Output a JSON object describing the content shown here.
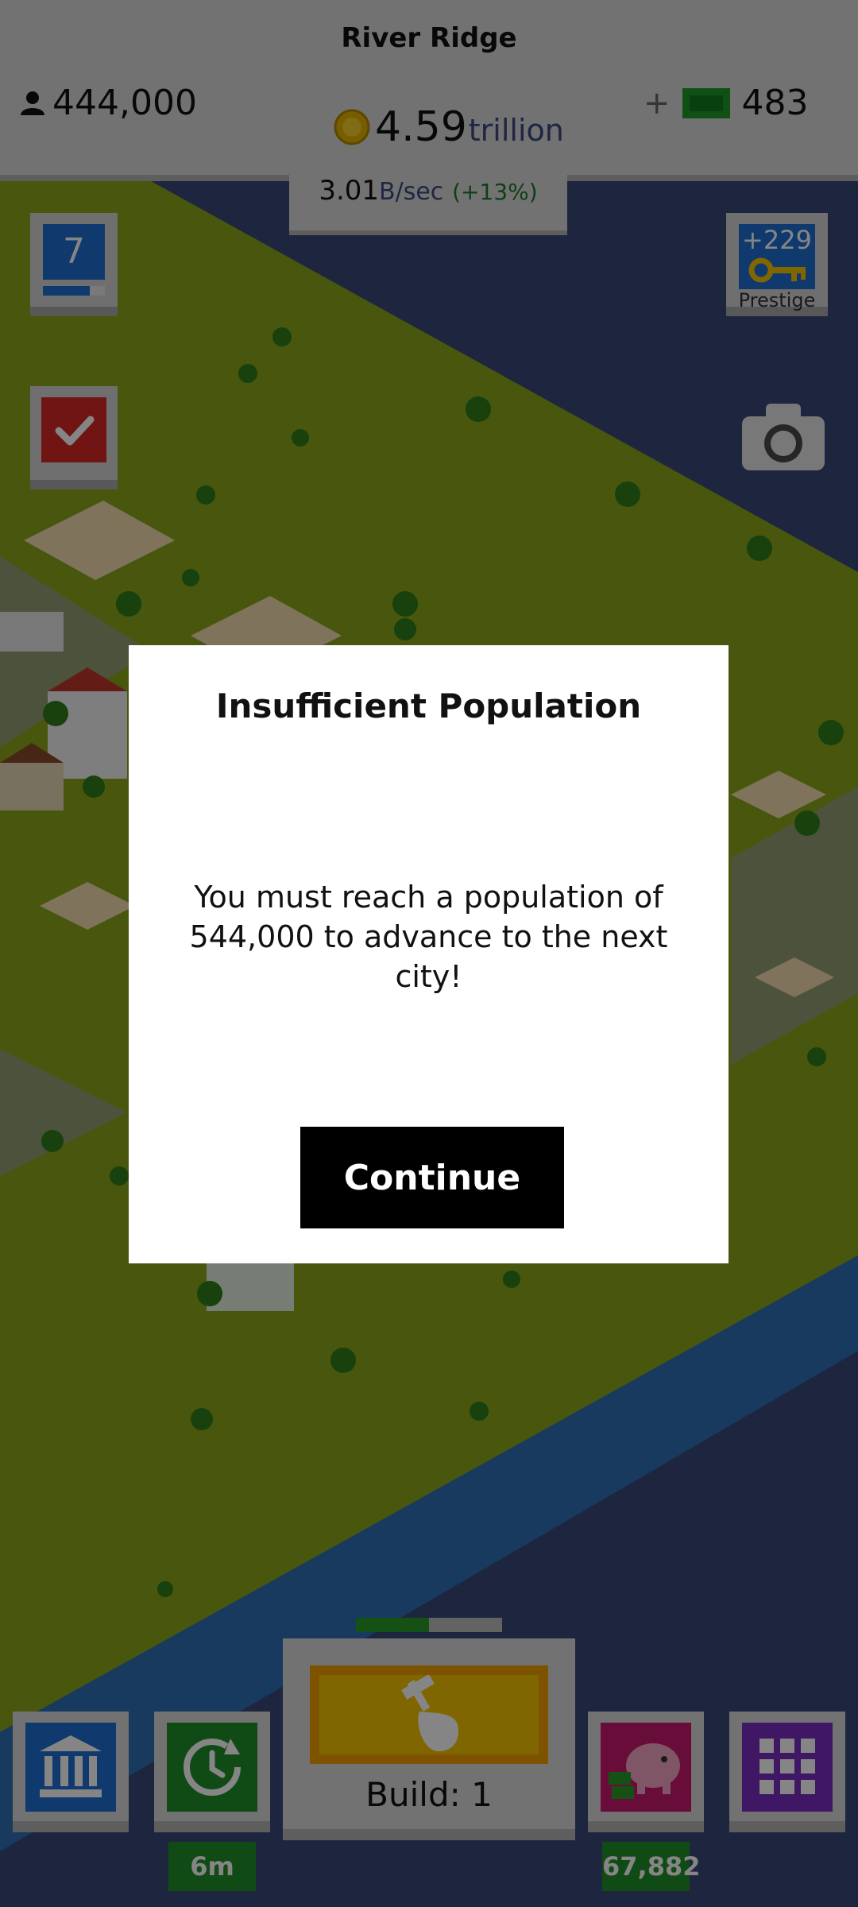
{
  "header": {
    "city_name": "River Ridge",
    "population": "444,000",
    "coins_amount": "4.59",
    "coins_unit": "trillion",
    "rate_value": "3.01",
    "rate_unit": "B/sec",
    "rate_change": "(+13%)",
    "cash_plus": "+",
    "cash_amount": "483"
  },
  "side_buttons": {
    "level_value": "7",
    "level_progress": 0.75,
    "prestige_value": "+229",
    "prestige_label": "Prestige"
  },
  "dialog": {
    "title": "Insufficient Population",
    "message": "You must reach a population of\n544,000  to advance to the next city!",
    "continue_label": "Continue"
  },
  "bottom_bar": {
    "build_label": "Build: 1",
    "build_progress": 0.5,
    "timer_label": "6m",
    "bank_value": "67,882"
  },
  "icons": [
    "person-icon",
    "coin-icon",
    "cash-icon",
    "checkmark-icon",
    "key-icon",
    "camera-icon",
    "bank-icon",
    "clock-icon",
    "hammer-hand-icon",
    "piggy-bank-icon",
    "grid-icon"
  ],
  "colors": {
    "level_blue": "#1f6fd1",
    "task_red": "#d62828",
    "bank_blue": "#1f6fd1",
    "timer_green": "#1f8f2a",
    "build_yellow": "#f5c400",
    "piggy_pink": "#c81a6e",
    "grid_purple": "#7b2cc2",
    "grass": "#8aa61c",
    "water": "#2c6fb5",
    "sky": "#3a4a7a"
  }
}
